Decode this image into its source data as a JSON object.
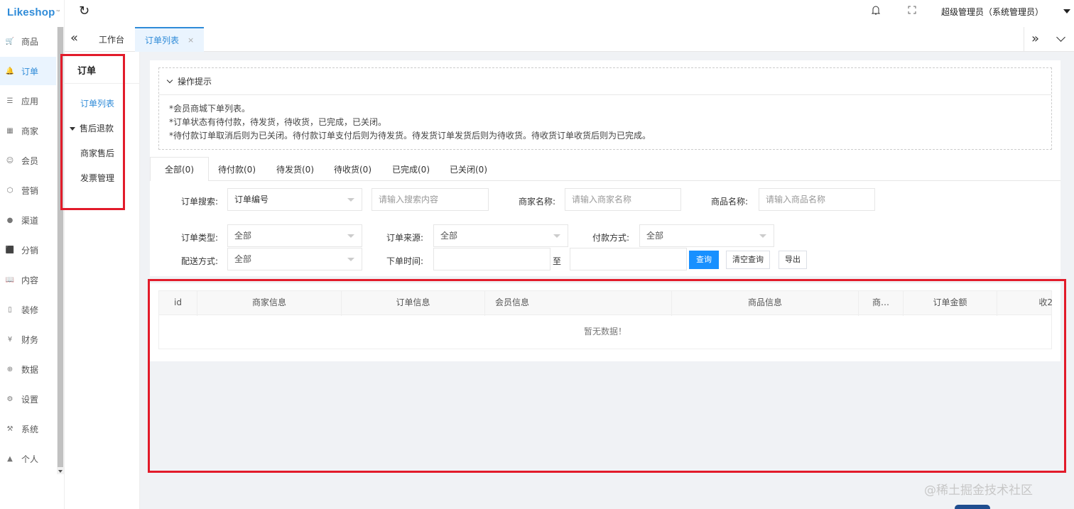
{
  "app": {
    "logo": "Likeshop",
    "logo_tm": "™"
  },
  "rail": {
    "items": [
      {
        "label": "商品",
        "icon": "cart-icon"
      },
      {
        "label": "订单",
        "icon": "bell-icon",
        "active": true
      },
      {
        "label": "应用",
        "icon": "list-icon"
      },
      {
        "label": "商家",
        "icon": "shop-icon"
      },
      {
        "label": "会员",
        "icon": "user-icon"
      },
      {
        "label": "营销",
        "icon": "cube-icon"
      },
      {
        "label": "渠道",
        "icon": "globe-dark-icon"
      },
      {
        "label": "分销",
        "icon": "layers-icon"
      },
      {
        "label": "内容",
        "icon": "book-icon"
      },
      {
        "label": "装修",
        "icon": "phone-icon"
      },
      {
        "label": "财务",
        "icon": "yen-icon"
      },
      {
        "label": "数据",
        "icon": "globe-icon"
      },
      {
        "label": "设置",
        "icon": "gear-icon"
      },
      {
        "label": "系统",
        "icon": "tools-icon"
      },
      {
        "label": "个人",
        "icon": "person-icon"
      }
    ]
  },
  "header": {
    "user": "超级管理员（系统管理员）"
  },
  "tabs": {
    "items": [
      {
        "label": "工作台"
      },
      {
        "label": "订单列表",
        "close": "×",
        "active": true
      }
    ]
  },
  "submenu": {
    "title": "订单",
    "items": [
      {
        "label": "订单列表",
        "active": true
      },
      {
        "label": "售后退款",
        "group": true
      },
      {
        "label": "商家售后"
      },
      {
        "label": "发票管理"
      }
    ]
  },
  "tips": {
    "title": "操作提示",
    "lines": [
      "*会员商城下单列表。",
      "*订单状态有待付款，待发货，待收货，已完成，已关闭。",
      "*待付款订单取消后则为已关闭。待付款订单支付后则为待发货。待发货订单发货后则为待收货。待收货订单收货后则为已完成。"
    ]
  },
  "status_tabs": [
    "全部(0)",
    "待付款(0)",
    "待发货(0)",
    "待收货(0)",
    "已完成(0)",
    "已关闭(0)"
  ],
  "filters": {
    "order_search_label": "订单搜索:",
    "order_search_type": "订单编号",
    "search_placeholder": "请输入搜索内容",
    "merchant_label": "商家名称:",
    "merchant_placeholder": "请输入商家名称",
    "goods_label": "商品名称:",
    "goods_placeholder": "请输入商品名称",
    "order_type_label": "订单类型:",
    "order_type_value": "全部",
    "order_source_label": "订单来源:",
    "order_source_value": "全部",
    "pay_method_label": "付款方式:",
    "pay_method_value": "全部",
    "delivery_label": "配送方式:",
    "delivery_value": "全部",
    "time_label": "下单时间:",
    "to": "至",
    "search_btn": "查询",
    "clear_btn": "清空查询",
    "export_btn": "导出"
  },
  "table": {
    "columns": [
      "id",
      "商家信息",
      "订单信息",
      "会员信息",
      "商品信息",
      "商…",
      "订单金额",
      "收2"
    ],
    "empty": "暂无数据！"
  },
  "watermark": "@稀土掘金技术社区"
}
